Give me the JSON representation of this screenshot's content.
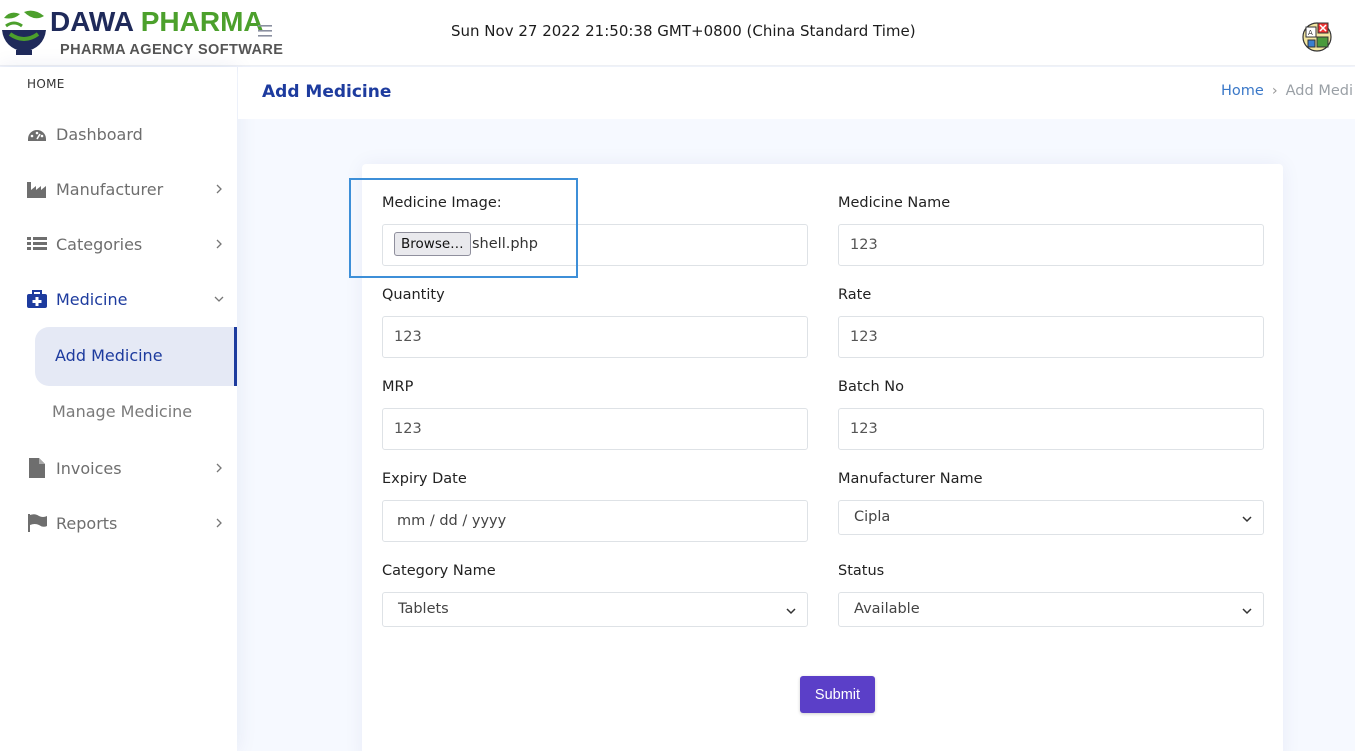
{
  "header": {
    "brand_word1": "DAWA",
    "brand_word2": "PHARMA",
    "brand_subtitle": "PHARMA AGENCY SOFTWARE",
    "datetime": "Sun Nov 27 2022 21:50:38 GMT+0800 (China Standard Time)",
    "menu_icon": "hamburger-icon",
    "avatar_icon": "user-avatar"
  },
  "sidebar": {
    "heading": "HOME",
    "items": [
      {
        "label": "Dashboard",
        "icon": "dashboard-icon",
        "has_chevron": false
      },
      {
        "label": "Manufacturer",
        "icon": "factory-icon",
        "has_chevron": true
      },
      {
        "label": "Categories",
        "icon": "list-icon",
        "has_chevron": true
      },
      {
        "label": "Medicine",
        "icon": "medkit-icon",
        "has_chevron": true,
        "expanded": true
      },
      {
        "label": "Invoices",
        "icon": "file-icon",
        "has_chevron": true
      },
      {
        "label": "Reports",
        "icon": "flag-icon",
        "has_chevron": true
      }
    ],
    "subitems": [
      {
        "label": "Add Medicine",
        "active": true
      },
      {
        "label": "Manage Medicine",
        "active": false
      }
    ]
  },
  "pagetitle": {
    "title": "Add Medicine",
    "breadcrumb_home": "Home",
    "breadcrumb_current": "Add Medi"
  },
  "form": {
    "image_label": "Medicine Image:",
    "browse_label": "Browse…",
    "file_name": "shell.php",
    "name_label": "Medicine Name",
    "name_value": "123",
    "quantity_label": "Quantity",
    "quantity_value": "123",
    "rate_label": "Rate",
    "rate_value": "123",
    "mrp_label": "MRP",
    "mrp_value": "123",
    "batch_label": "Batch No",
    "batch_value": "123",
    "expiry_label": "Expiry Date",
    "expiry_placeholder": "mm / dd / yyyy",
    "manufacturer_label": "Manufacturer Name",
    "manufacturer_value": "Cipla",
    "category_label": "Category Name",
    "category_value": "Tablets",
    "status_label": "Status",
    "status_value": "Available",
    "submit_label": "Submit"
  },
  "colors": {
    "primary": "#1d3b9e",
    "submit": "#5b3fc8",
    "highlight": "#3d8fd8",
    "brand_green": "#4ca02c"
  }
}
